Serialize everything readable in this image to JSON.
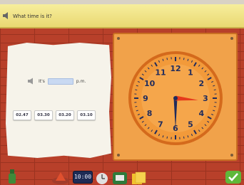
{
  "title": "What time is it?",
  "question": {
    "prefix": "It's",
    "suffix": "p.m."
  },
  "options": [
    "02.47",
    "03.30",
    "03.20",
    "03.10"
  ],
  "clock": {
    "numbers": [
      "12",
      "1",
      "2",
      "3",
      "4",
      "5",
      "6",
      "7",
      "8",
      "9",
      "10",
      "11"
    ],
    "hour_hand_angle_deg": 95,
    "minute_hand_angle_deg": 180,
    "colors": {
      "face": "#f29a3a",
      "hour_hand": "#e63a1c",
      "minute_hand": "#1f2b5c",
      "numbers": "#1f2b5c"
    }
  },
  "toolbar": {
    "digital_readout": "10:00",
    "icons": [
      "bottle-icon",
      "shape-tool-icon",
      "digital-clock-icon",
      "analog-clock-icon",
      "book-icon",
      "files-icon",
      "check-icon"
    ]
  },
  "colors": {
    "title_bar": "#f1e28a",
    "paper": "#f6f3ea",
    "board": "#f1a24a",
    "wall": "#b8402a",
    "answer_box": "#c9d9f2"
  }
}
